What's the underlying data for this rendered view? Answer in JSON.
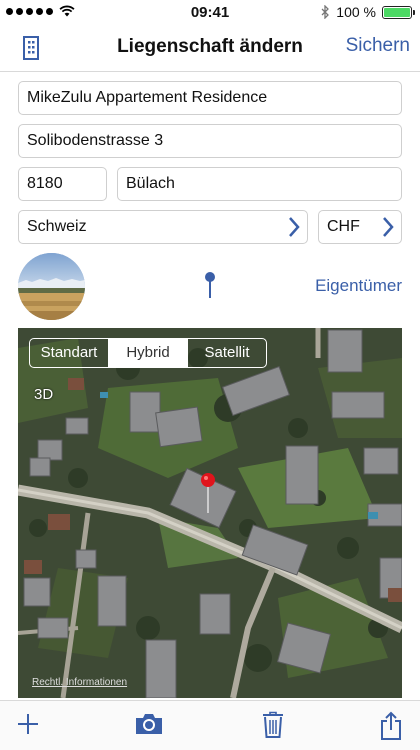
{
  "status_bar": {
    "time": "09:41",
    "battery_text": "100 %",
    "battery_level": 1.0,
    "bluetooth_icon": "bluetooth-icon",
    "wifi_icon": "wifi-icon"
  },
  "nav": {
    "title": "Liegenschaft ändern",
    "save_label": "Sichern",
    "left_icon": "building-icon"
  },
  "form": {
    "name": "MikeZulu Appartement Residence",
    "street": "Solibodenstrasse 3",
    "zip": "8180",
    "city": "Bülach",
    "country": "Schweiz",
    "currency": "CHF"
  },
  "owner_label": "Eigentümer",
  "map": {
    "modes": [
      "Standart",
      "Hybrid",
      "Satellit"
    ],
    "selected_mode": "Hybrid",
    "three_d_label": "3D",
    "legal_label": "Rechtl. Informationen"
  },
  "toolbar": {
    "icons": [
      "plus-icon",
      "camera-icon",
      "trash-icon",
      "share-icon"
    ]
  },
  "colors": {
    "accent": "#3a5fa8",
    "battery": "#4cd964",
    "pin": "#e0141c"
  }
}
